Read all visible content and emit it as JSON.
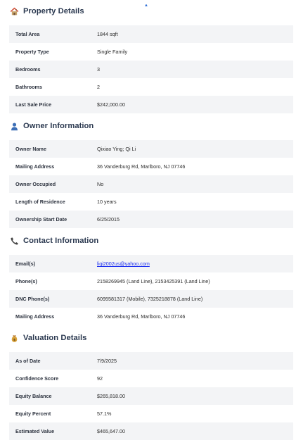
{
  "sections": [
    {
      "title": "Property Details",
      "icon": "house-icon",
      "rows": [
        {
          "label": "Total Area",
          "value": "1844 sqft"
        },
        {
          "label": "Property Type",
          "value": "Single Family"
        },
        {
          "label": "Bedrooms",
          "value": "3"
        },
        {
          "label": "Bathrooms",
          "value": "2"
        },
        {
          "label": "Last Sale Price",
          "value": "$242,000.00"
        }
      ]
    },
    {
      "title": "Owner Information",
      "icon": "person-icon",
      "rows": [
        {
          "label": "Owner Name",
          "value": "Qixiao Ying; Qi Li"
        },
        {
          "label": "Mailing Address",
          "value": "36 Vanderburg Rd, Marlboro, NJ 07746"
        },
        {
          "label": "Owner Occupied",
          "value": "No"
        },
        {
          "label": "Length of Residence",
          "value": "10 years"
        },
        {
          "label": "Ownership Start Date",
          "value": "6/25/2015"
        }
      ]
    },
    {
      "title": "Contact Information",
      "icon": "phone-icon",
      "rows": [
        {
          "label": "Email(s)",
          "value": "liqi2002us@yahoo.com",
          "link": true
        },
        {
          "label": "Phone(s)",
          "value": "2158269945 (Land Line), 2153425391 (Land Line)"
        },
        {
          "label": "DNC Phone(s)",
          "value": "6095581317 (Mobile), 7325218878 (Land Line)"
        },
        {
          "label": "Mailing Address",
          "value": "36 Vanderburg Rd, Marlboro, NJ 07746"
        }
      ]
    },
    {
      "title": "Valuation Details",
      "icon": "money-bag-icon",
      "rows": [
        {
          "label": "As of Date",
          "value": "7/9/2025"
        },
        {
          "label": "Confidence Score",
          "value": "92"
        },
        {
          "label": "Equity Balance",
          "value": "$265,818.00"
        },
        {
          "label": "Equity Percent",
          "value": "57.1%"
        },
        {
          "label": "Estimated Value",
          "value": "$465,647.00"
        }
      ]
    }
  ],
  "colors": {
    "title": "#2b3950",
    "row_alt": "#f3f4f6",
    "link": "#1d2ff0"
  }
}
